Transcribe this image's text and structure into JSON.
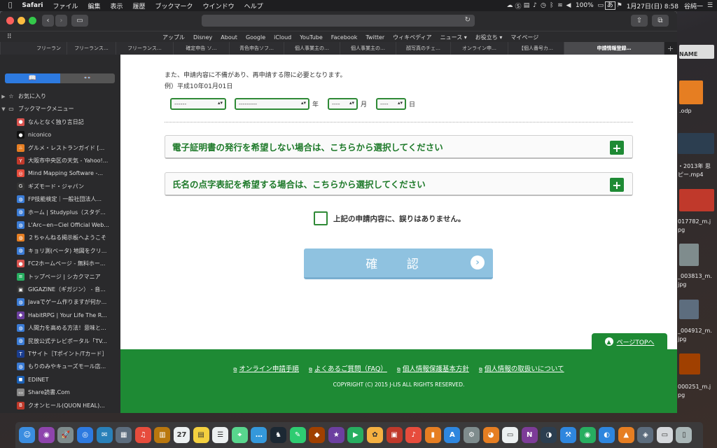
{
  "menubar": {
    "apple": "",
    "app": "Safari",
    "items": [
      "ファイル",
      "編集",
      "表示",
      "履歴",
      "ブックマーク",
      "ウインドウ",
      "ヘルプ"
    ],
    "battery": "100%",
    "input_method": "あ",
    "datetime": "1月27日(日)  8:58",
    "user": "谷純一"
  },
  "browser": {
    "url": "",
    "favorites": [
      "アップル",
      "Disney",
      "About",
      "Google",
      "iCloud",
      "YouTube",
      "Facebook",
      "Twitter",
      "ウィキペディア",
      "ニュース ▾",
      "お役立ち ▾",
      "マイページ"
    ],
    "tabs": [
      {
        "label": "フリーラン",
        "active": false
      },
      {
        "label": "フリーランス…",
        "active": false
      },
      {
        "label": "フリーランス…",
        "active": false
      },
      {
        "label": "確定申告 ソ…",
        "active": false
      },
      {
        "label": "青色申告ソフ…",
        "active": false
      },
      {
        "label": "個人事業主の…",
        "active": false
      },
      {
        "label": "個人事業主の…",
        "active": false
      },
      {
        "label": "顔写真のチェ…",
        "active": false
      },
      {
        "label": "オンライン申…",
        "active": false
      },
      {
        "label": "【個人番号カ…",
        "active": false
      },
      {
        "label": "申請情報登録…",
        "active": true
      }
    ]
  },
  "sidebar": {
    "segments": [
      "📖",
      "👓"
    ],
    "rows": [
      {
        "type": "folder",
        "tri": "▶",
        "icon": "☆",
        "label": "お気に入り"
      },
      {
        "type": "folder",
        "tri": "▼",
        "icon": "▭",
        "label": "ブックマークメニュー"
      },
      {
        "type": "item",
        "label": "なんとなく独り言日記",
        "color": "#d9534f",
        "glyph": "●"
      },
      {
        "type": "item",
        "label": "niconico",
        "color": "#111",
        "glyph": "●"
      },
      {
        "type": "item",
        "label": "グルメ・レストランガイド [...",
        "color": "#e67e22",
        "glyph": "♨"
      },
      {
        "type": "item",
        "label": "大阪市中央区の天気 - Yahoo!...",
        "color": "#c0392b",
        "glyph": "Y"
      },
      {
        "type": "item",
        "label": "Mind Mapping Software -...",
        "color": "#e74c3c",
        "glyph": "◎"
      },
      {
        "type": "item",
        "label": "ギズモード・ジャパン",
        "color": "#333",
        "glyph": "G"
      },
      {
        "type": "item",
        "label": "FP技能検定｜一般社団法人...",
        "color": "#3a7bd5",
        "glyph": "◍"
      },
      {
        "type": "item",
        "label": "ホーム | Studyplus（スタデ...",
        "color": "#3a7bd5",
        "glyph": "◍"
      },
      {
        "type": "item",
        "label": "L'Arc~en~Ciel Official Web...",
        "color": "#3a7bd5",
        "glyph": "◍"
      },
      {
        "type": "item",
        "label": "２ちゃんねる掲示板へようこそ",
        "color": "#e67e22",
        "glyph": "◍"
      },
      {
        "type": "item",
        "label": "キョリ測(ベータ) 地図をクリ...",
        "color": "#3a7bd5",
        "glyph": "◍"
      },
      {
        "type": "item",
        "label": "FC2ホームページ - 無料ホー...",
        "color": "#d9534f",
        "glyph": "●"
      },
      {
        "type": "item",
        "label": "トップページ | シカクマニア",
        "color": "#27ae60",
        "glyph": "≡"
      },
      {
        "type": "item",
        "label": "GIGAZINE（ギガジン） - 音...",
        "color": "#333",
        "glyph": "▣"
      },
      {
        "type": "item",
        "label": "Javaでゲーム作りますが何か...",
        "color": "#3a7bd5",
        "glyph": "◍"
      },
      {
        "type": "item",
        "label": "HabitRPG | Your Life The R...",
        "color": "#6c3fa0",
        "glyph": "◆"
      },
      {
        "type": "item",
        "label": "人間力を高める方法！意味と...",
        "color": "#3a7bd5",
        "glyph": "◍"
      },
      {
        "type": "item",
        "label": "民放公式テレビポータル「TV...",
        "color": "#3a7bd5",
        "glyph": "◍"
      },
      {
        "type": "item",
        "label": "Tサイト［Tポイント/Tカード］",
        "color": "#1a3d8f",
        "glyph": "T"
      },
      {
        "type": "item",
        "label": "もりのみやキューズモール店...",
        "color": "#3a7bd5",
        "glyph": "◍"
      },
      {
        "type": "item",
        "label": "EDINET",
        "color": "#1a5fb4",
        "glyph": "◼"
      },
      {
        "type": "item",
        "label": "Share読書.Com",
        "color": "#888",
        "glyph": "▭"
      },
      {
        "type": "item",
        "label": "クオンヒール(QUON HEAL)...",
        "color": "#c0392b",
        "glyph": "B"
      },
      {
        "type": "folder",
        "tri": "▶",
        "icon": "▭",
        "label": "生活役立ち"
      }
    ]
  },
  "form": {
    "note": "また、申請内容に不備があり、再申請する際に必要となります。",
    "example": "例）平成10年01月01日",
    "era_value": "------",
    "year_value": "---------",
    "year_unit": "年",
    "month_value": "----",
    "month_unit": "月",
    "day_value": "----",
    "day_unit": "日",
    "accordion1": "電子証明書の発行を希望しない場合は、こちらから選択してください",
    "accordion2": "氏名の点字表記を希望する場合は、こちらから選択してください",
    "plus": "+",
    "agree_label": "上記の申請内容に、誤りはありません。",
    "confirm_label": "確 認",
    "confirm_arrow": "›"
  },
  "footer": {
    "pagetop": "ページTOPへ",
    "links": [
      "オンライン申請手順",
      "よくあるご質問（FAQ）",
      "個人情報保護基本方針",
      "個人情報の取扱いについて"
    ],
    "copyright": "COPYRIGHT (C) 2015 J-LIS ALL RIGHTS RESERVED."
  },
  "desktop": {
    "labels": [
      " NAME",
      ".odp",
      "・2013年 思",
      "ピー.mp4",
      "017782_m.j",
      "pg",
      "_003813_m.",
      "jpg",
      "_004912_m.",
      "jpg",
      "000251_m.j",
      "pg"
    ]
  },
  "dock": {
    "apps": [
      {
        "name": "finder",
        "color": "#3b8de0",
        "glyph": "☺"
      },
      {
        "name": "siri",
        "color": "#8e44ad",
        "glyph": "◉"
      },
      {
        "name": "launchpad",
        "color": "#7f8c8d",
        "glyph": "🚀"
      },
      {
        "name": "safari",
        "color": "#2d7ae0",
        "glyph": "◎"
      },
      {
        "name": "mail-bird",
        "color": "#2980b9",
        "glyph": "✉"
      },
      {
        "name": "preview",
        "color": "#5d6d7e",
        "glyph": "▦"
      },
      {
        "name": "music",
        "color": "#e74c3c",
        "glyph": "♫"
      },
      {
        "name": "contacts",
        "color": "#b9770e",
        "glyph": "▥"
      },
      {
        "name": "calendar",
        "color": "#ecf0f1",
        "glyph": "27"
      },
      {
        "name": "notes",
        "color": "#f4d03f",
        "glyph": "▤"
      },
      {
        "name": "reminders",
        "color": "#ecf0f1",
        "glyph": "☰"
      },
      {
        "name": "maps",
        "color": "#58d68d",
        "glyph": "⌖"
      },
      {
        "name": "messages",
        "color": "#3498db",
        "glyph": "…"
      },
      {
        "name": "reading",
        "color": "#1c2833",
        "glyph": "♞"
      },
      {
        "name": "evernote",
        "color": "#2ecc71",
        "glyph": "✎"
      },
      {
        "name": "lion",
        "color": "#a04000",
        "glyph": "◆"
      },
      {
        "name": "imovie",
        "color": "#6c3fa0",
        "glyph": "★"
      },
      {
        "name": "facetime",
        "color": "#27ae60",
        "glyph": "▶"
      },
      {
        "name": "photos",
        "color": "#f5b041",
        "glyph": "✿"
      },
      {
        "name": "photo-booth",
        "color": "#c0392b",
        "glyph": "▣"
      },
      {
        "name": "itunes",
        "color": "#e74c3c",
        "glyph": "♪"
      },
      {
        "name": "books",
        "color": "#e67e22",
        "glyph": "▮"
      },
      {
        "name": "appstore",
        "color": "#2e86de",
        "glyph": "A"
      },
      {
        "name": "system-prefs",
        "color": "#7f8c8d",
        "glyph": "⚙"
      },
      {
        "name": "firefox",
        "color": "#e67e22",
        "glyph": "◕"
      },
      {
        "name": "textedit",
        "color": "#ecf0f1",
        "glyph": "▭"
      },
      {
        "name": "onenote",
        "color": "#7d3c98",
        "glyph": "N"
      },
      {
        "name": "eclipse",
        "color": "#2c3e50",
        "glyph": "◑"
      },
      {
        "name": "xcode",
        "color": "#2e86de",
        "glyph": "⚒"
      },
      {
        "name": "chrome",
        "color": "#27ae60",
        "glyph": "◉"
      },
      {
        "name": "edge",
        "color": "#2e86de",
        "glyph": "◐"
      },
      {
        "name": "vlc",
        "color": "#e67e22",
        "glyph": "▲"
      },
      {
        "name": "pixelmator",
        "color": "#5d6d7e",
        "glyph": "◈"
      },
      {
        "name": "downloads",
        "color": "#d5d8dc",
        "glyph": "▭"
      },
      {
        "name": "trash",
        "color": "#aab7b8",
        "glyph": "▯"
      }
    ]
  }
}
